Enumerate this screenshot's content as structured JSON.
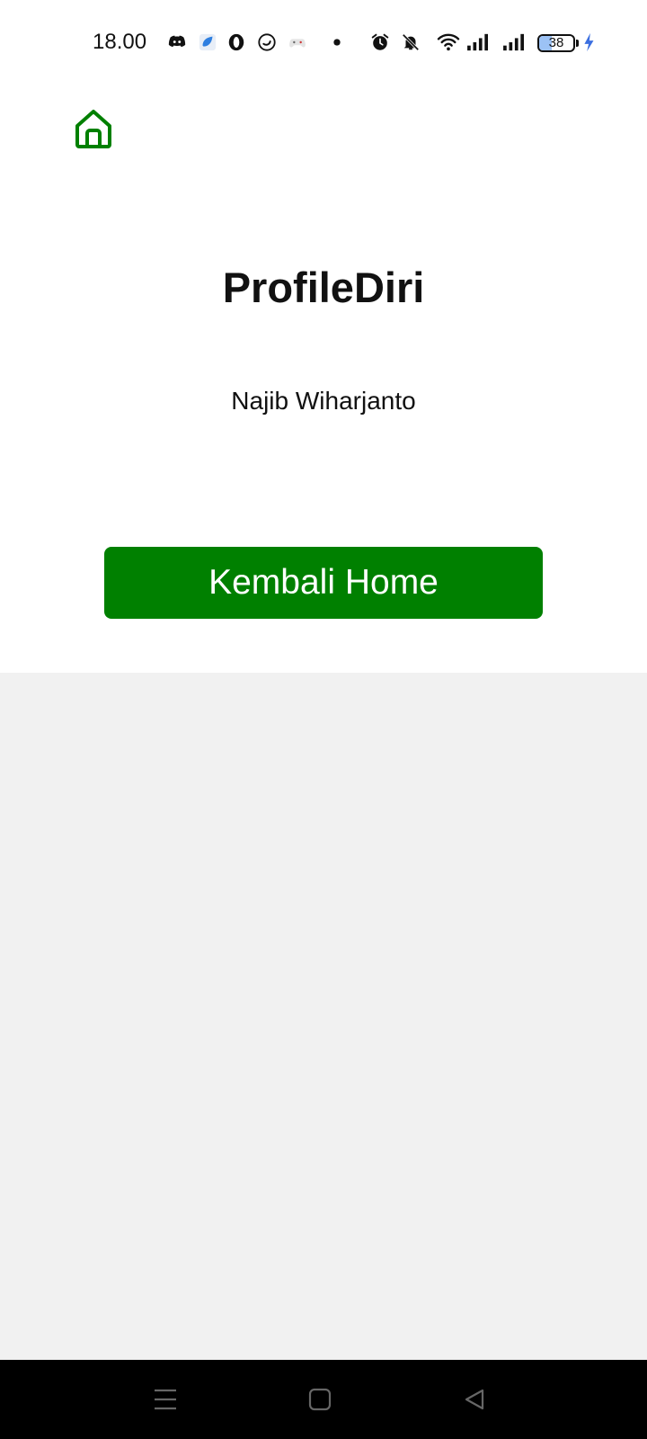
{
  "status_bar": {
    "time": "18.00",
    "battery_level": "38",
    "battery_fraction": 0.38,
    "icons": [
      "discord-icon",
      "app-icon",
      "opera-icon",
      "circle-app-icon",
      "game-controller-icon",
      "dot-icon",
      "alarm-icon",
      "mute-icon",
      "wifi-icon",
      "signal-icon",
      "signal-icon",
      "battery-icon",
      "charging-icon"
    ]
  },
  "app": {
    "title": "ProfileDiri",
    "name": "Najib Wiharjanto",
    "button_label": "Kembali Home",
    "accent_color": "#008000"
  },
  "nav_bar": {
    "buttons": [
      "menu-button",
      "home-button",
      "back-button"
    ]
  }
}
